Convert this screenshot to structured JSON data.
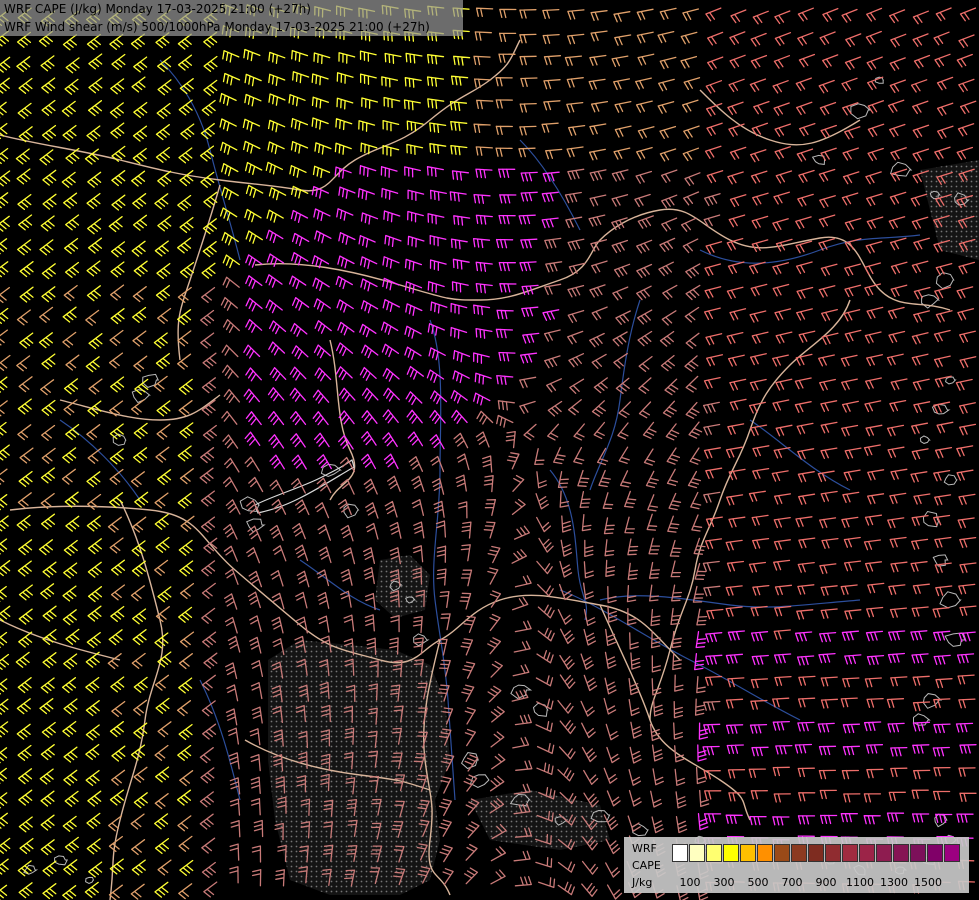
{
  "header": {
    "cape_title": "WRF CAPE (J/kg) Monday 17-03-2025 21:00 (+27h)",
    "shear_title": "WRF Wind shear (m/s) 500/1000hPa Monday 17-03-2025 21:00 (+27h)"
  },
  "legend": {
    "model": "WRF",
    "variable": "CAPE",
    "unit": "J/kg",
    "colors": [
      "#ffffff",
      "#ffffc0",
      "#ffff70",
      "#ffff00",
      "#ffc000",
      "#ff9000",
      "#9a4a18",
      "#8c3a20",
      "#7e2c20",
      "#902c30",
      "#a02c40",
      "#9c2448",
      "#8e1c50",
      "#861454",
      "#7c105a",
      "#800068",
      "#9c0080"
    ],
    "tick_labels": [
      "100",
      "300",
      "500",
      "700",
      "900",
      "1100",
      "1300",
      "1500"
    ]
  },
  "map": {
    "barb_colors": {
      "weak": "#c87a78",
      "moderate": "#e0a06a",
      "strong": "#ffff33",
      "very_strong": "#ff33ff",
      "east": "#ee6e6a"
    },
    "border_color": "#d8b49a",
    "river_color": "#2c4e9c",
    "elevation_color": "#b8b8b8"
  }
}
